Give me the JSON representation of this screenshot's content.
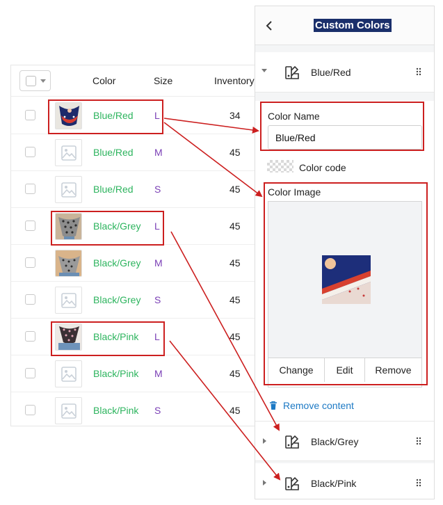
{
  "table": {
    "headers": {
      "color": "Color",
      "size": "Size",
      "inventory": "Inventory"
    },
    "rows": [
      {
        "color": "Blue/Red",
        "size": "L",
        "inventory": "34",
        "thumb": "blue-red-bandana"
      },
      {
        "color": "Blue/Red",
        "size": "M",
        "inventory": "45",
        "thumb": "placeholder"
      },
      {
        "color": "Blue/Red",
        "size": "S",
        "inventory": "45",
        "thumb": "placeholder"
      },
      {
        "color": "Black/Grey",
        "size": "L",
        "inventory": "45",
        "thumb": "leopard-bandana"
      },
      {
        "color": "Black/Grey",
        "size": "M",
        "inventory": "45",
        "thumb": "leopard-bandana"
      },
      {
        "color": "Black/Grey",
        "size": "S",
        "inventory": "45",
        "thumb": "placeholder"
      },
      {
        "color": "Black/Pink",
        "size": "L",
        "inventory": "45",
        "thumb": "pink-bandana"
      },
      {
        "color": "Black/Pink",
        "size": "M",
        "inventory": "45",
        "thumb": "placeholder"
      },
      {
        "color": "Black/Pink",
        "size": "S",
        "inventory": "45",
        "thumb": "placeholder"
      }
    ]
  },
  "panel": {
    "title": "Custom Colors",
    "sections": [
      {
        "label": "Blue/Red",
        "expanded": true
      },
      {
        "label": "Black/Grey",
        "expanded": false
      },
      {
        "label": "Black/Pink",
        "expanded": false
      }
    ],
    "color_name_label": "Color Name",
    "color_name_value": "Blue/Red",
    "color_code_label": "Color code",
    "color_image_label": "Color Image",
    "image_actions": {
      "change": "Change",
      "edit": "Edit",
      "remove": "Remove"
    },
    "remove_content": "Remove content"
  },
  "colors": {
    "variant_text": "#2db45e",
    "size_text": "#7a3fb5",
    "highlight": "#cc1f1f",
    "link": "#1c79c4",
    "title_bg": "#1a2f6b"
  }
}
